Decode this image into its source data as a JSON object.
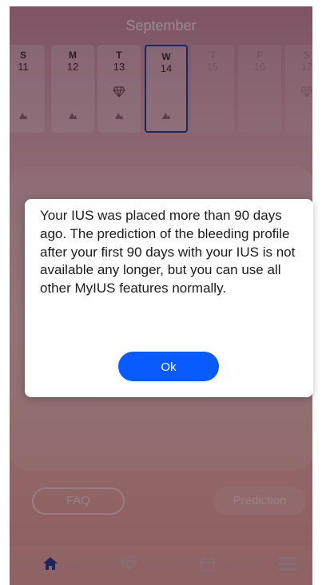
{
  "calendar": {
    "month": "September",
    "days": [
      {
        "letter": "S",
        "number": "11",
        "icons": [
          "drop-icon"
        ],
        "state": "past"
      },
      {
        "letter": "M",
        "number": "12",
        "icons": [
          "drop-icon"
        ],
        "state": "past"
      },
      {
        "letter": "T",
        "number": "13",
        "icons": [
          "gem-icon",
          "drop-icon"
        ],
        "state": "past"
      },
      {
        "letter": "W",
        "number": "14",
        "icons": [
          "drop-icon"
        ],
        "state": "selected"
      },
      {
        "letter": "T",
        "number": "15",
        "icons": [],
        "state": "future"
      },
      {
        "letter": "F",
        "number": "16",
        "icons": [],
        "state": "future"
      },
      {
        "letter": "S",
        "number": "17",
        "icons": [
          "gem-icon"
        ],
        "state": "future"
      }
    ]
  },
  "actions": {
    "faq_label": "FAQ",
    "prediction_label": "Prediction"
  },
  "bottom_nav": {
    "items": [
      "home-icon",
      "gem-icon",
      "calendar-icon",
      "menu-icon"
    ],
    "active": "home-icon",
    "active_color": "#1e3f93"
  },
  "dialog": {
    "message": "Your IUS was placed more than 90 days ago. The prediction of the bleeding profile after your first 90 days with your IUS is not available any longer, but you can use all other MyIUS features normally.",
    "ok_label": "Ok",
    "ok_color": "#0a5bff"
  }
}
